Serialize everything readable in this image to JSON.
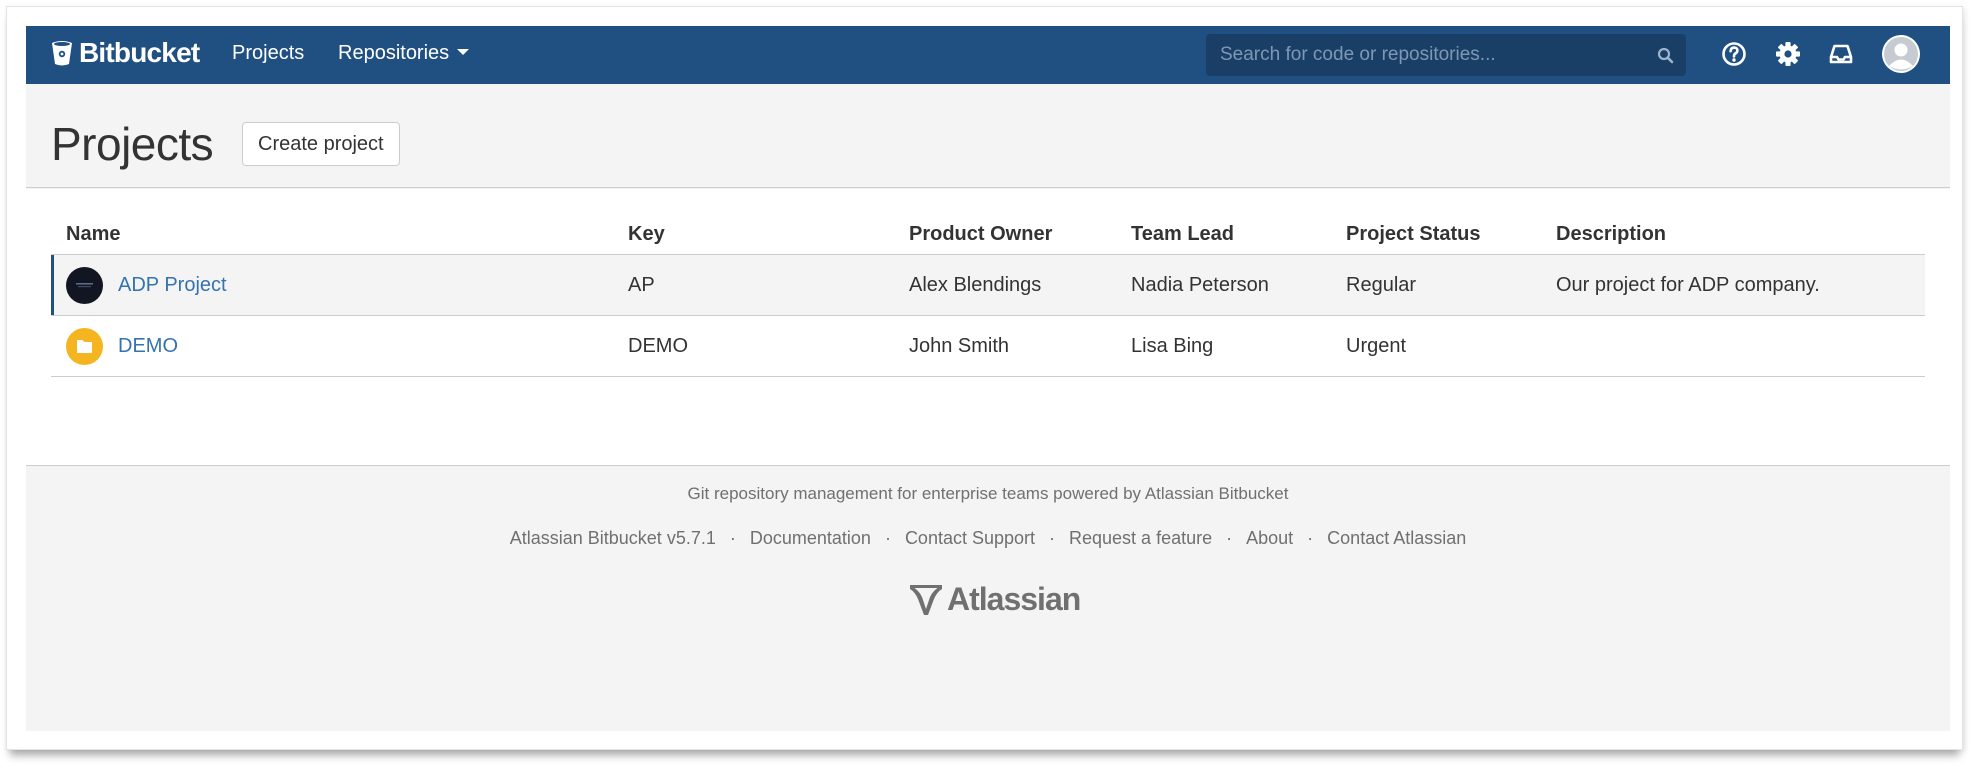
{
  "header": {
    "brand": "Bitbucket",
    "nav": {
      "projects": "Projects",
      "repositories": "Repositories"
    },
    "search": {
      "placeholder": "Search for code or repositories..."
    },
    "icons": [
      "help-icon",
      "gear-icon",
      "inbox-icon",
      "avatar"
    ],
    "color": "#205081"
  },
  "page": {
    "title": "Projects",
    "create_button": "Create project"
  },
  "table": {
    "columns": [
      "Name",
      "Key",
      "Product Owner",
      "Team Lead",
      "Project Status",
      "Description"
    ],
    "rows": [
      {
        "name": "ADP Project",
        "key": "AP",
        "product_owner": "Alex Blendings",
        "team_lead": "Nadia Peterson",
        "status": "Regular",
        "description": "Our project for ADP company.",
        "avatar_color": "#111622"
      },
      {
        "name": "DEMO",
        "key": "DEMO",
        "product_owner": "John Smith",
        "team_lead": "Lisa Bing",
        "status": "Urgent",
        "description": "",
        "avatar_color": "#f5b521"
      }
    ]
  },
  "footer": {
    "tagline": "Git repository management for enterprise teams powered by Atlassian Bitbucket",
    "links": [
      "Atlassian Bitbucket v5.7.1",
      "Documentation",
      "Contact Support",
      "Request a feature",
      "About",
      "Contact Atlassian"
    ],
    "logo_text": "Atlassian"
  },
  "colors": {
    "link": "#3572b0",
    "page_background": "#f4f4f4"
  }
}
